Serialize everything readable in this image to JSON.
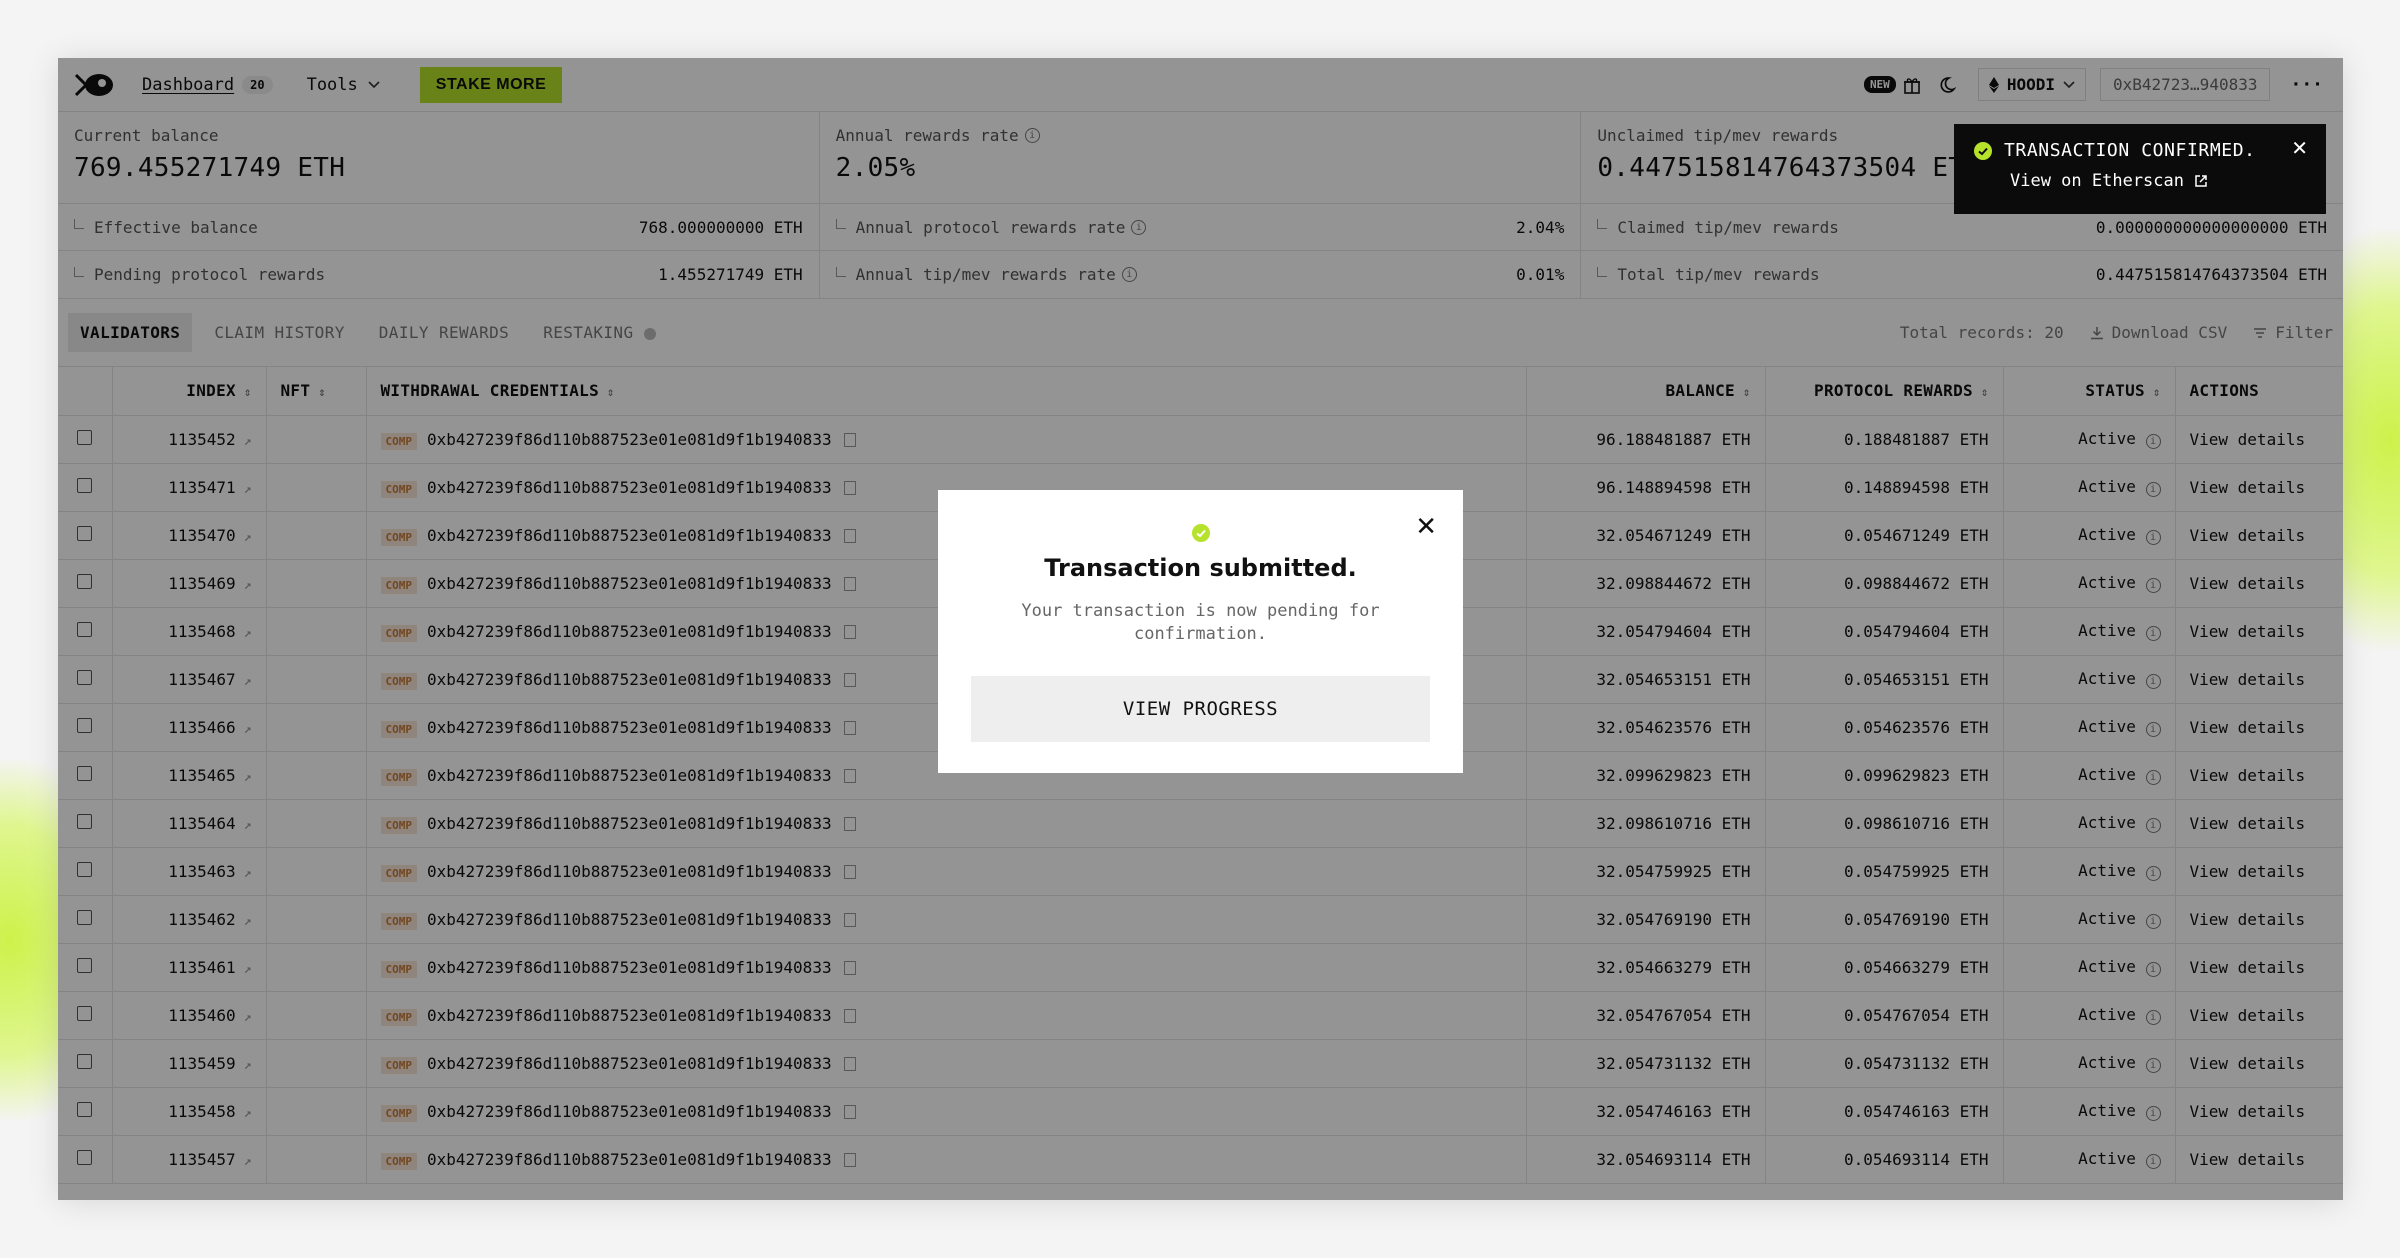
{
  "header": {
    "nav_dashboard": "Dashboard",
    "nav_badge": "20",
    "tools_label": "Tools",
    "stake_label": "STAKE MORE",
    "new_badge": "NEW",
    "network": "HOODI",
    "address": "0xB42723…940833",
    "more": "···"
  },
  "stats": {
    "current_balance_label": "Current balance",
    "current_balance_value": "769.455271749 ETH",
    "effective_balance_label": "Effective balance",
    "effective_balance_value": "768.000000000 ETH",
    "pending_label": "Pending protocol rewards",
    "pending_value": "1.455271749 ETH",
    "annual_rate_label": "Annual rewards rate",
    "annual_rate_value": "2.05%",
    "protocol_rate_label": "Annual protocol rewards rate",
    "protocol_rate_value": "2.04%",
    "tip_rate_label": "Annual tip/mev rewards rate",
    "tip_rate_value": "0.01%",
    "unclaimed_label": "Unclaimed tip/mev rewards",
    "unclaimed_value": "0.447515814764373504 ETH",
    "claimed_label": "Claimed tip/mev rewards",
    "claimed_value": "0.000000000000000000 ETH",
    "total_tip_label": "Total tip/mev rewards",
    "total_tip_value": "0.447515814764373504 ETH"
  },
  "tabs": {
    "items": [
      "VALIDATORS",
      "CLAIM HISTORY",
      "DAILY REWARDS",
      "RESTAKING"
    ],
    "total_records": "Total records: 20",
    "download": "Download CSV",
    "filter": "Filter"
  },
  "table": {
    "columns": [
      "INDEX",
      "NFT",
      "WITHDRAWAL CREDENTIALS",
      "BALANCE",
      "PROTOCOL REWARDS",
      "STATUS",
      "ACTIONS"
    ],
    "comp_tag": "COMP",
    "credential": "0xb427239f86d110b887523e01e081d9f1b1940833",
    "action": "View details",
    "rows": [
      {
        "index": "1135452",
        "balance": "96.188481887 ETH",
        "rewards": "0.188481887 ETH",
        "status": "Active"
      },
      {
        "index": "1135471",
        "balance": "96.148894598 ETH",
        "rewards": "0.148894598 ETH",
        "status": "Active"
      },
      {
        "index": "1135470",
        "balance": "32.054671249 ETH",
        "rewards": "0.054671249 ETH",
        "status": "Active"
      },
      {
        "index": "1135469",
        "balance": "32.098844672 ETH",
        "rewards": "0.098844672 ETH",
        "status": "Active"
      },
      {
        "index": "1135468",
        "balance": "32.054794604 ETH",
        "rewards": "0.054794604 ETH",
        "status": "Active"
      },
      {
        "index": "1135467",
        "balance": "32.054653151 ETH",
        "rewards": "0.054653151 ETH",
        "status": "Active"
      },
      {
        "index": "1135466",
        "balance": "32.054623576 ETH",
        "rewards": "0.054623576 ETH",
        "status": "Active"
      },
      {
        "index": "1135465",
        "balance": "32.099629823 ETH",
        "rewards": "0.099629823 ETH",
        "status": "Active"
      },
      {
        "index": "1135464",
        "balance": "32.098610716 ETH",
        "rewards": "0.098610716 ETH",
        "status": "Active"
      },
      {
        "index": "1135463",
        "balance": "32.054759925 ETH",
        "rewards": "0.054759925 ETH",
        "status": "Active"
      },
      {
        "index": "1135462",
        "balance": "32.054769190 ETH",
        "rewards": "0.054769190 ETH",
        "status": "Active"
      },
      {
        "index": "1135461",
        "balance": "32.054663279 ETH",
        "rewards": "0.054663279 ETH",
        "status": "Active"
      },
      {
        "index": "1135460",
        "balance": "32.054767054 ETH",
        "rewards": "0.054767054 ETH",
        "status": "Active"
      },
      {
        "index": "1135459",
        "balance": "32.054731132 ETH",
        "rewards": "0.054731132 ETH",
        "status": "Active"
      },
      {
        "index": "1135458",
        "balance": "32.054746163 ETH",
        "rewards": "0.054746163 ETH",
        "status": "Active"
      },
      {
        "index": "1135457",
        "balance": "32.054693114 ETH",
        "rewards": "0.054693114 ETH",
        "status": "Active"
      }
    ]
  },
  "modal": {
    "title": "Transaction submitted.",
    "description": "Your transaction is now pending for confirmation.",
    "button": "VIEW PROGRESS"
  },
  "toast": {
    "title": "TRANSACTION CONFIRMED.",
    "link": "View on Etherscan"
  },
  "colors": {
    "accent": "#b7e22b",
    "comp_tag": "#c47a3a"
  }
}
